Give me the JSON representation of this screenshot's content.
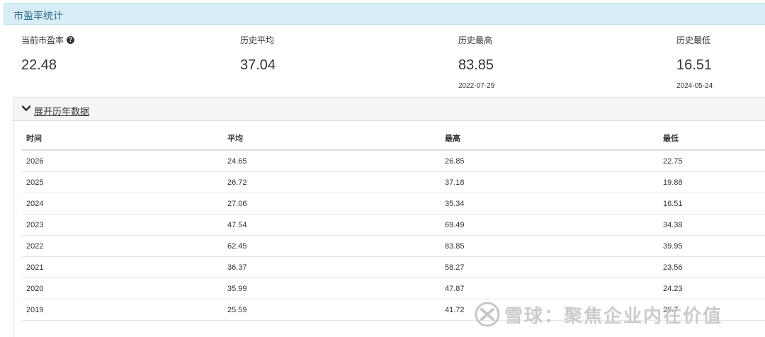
{
  "panel": {
    "title": "市盈率统计"
  },
  "stats": [
    {
      "label": "当前市盈率",
      "value": "22.48",
      "date": "",
      "has_help": true
    },
    {
      "label": "历史平均",
      "value": "37.04",
      "date": ""
    },
    {
      "label": "历史最高",
      "value": "83.85",
      "date": "2022-07-29"
    },
    {
      "label": "历史最低",
      "value": "16.51",
      "date": "2024-05-24"
    }
  ],
  "help_icon": "question-circle-icon",
  "expander": {
    "label": "展开历年数据",
    "icon": "chevron-down-icon"
  },
  "table": {
    "headers": [
      "时间",
      "平均",
      "最高",
      "最低"
    ],
    "rows": [
      [
        "2026",
        "24.65",
        "26.85",
        "22.75"
      ],
      [
        "2025",
        "26.72",
        "37.18",
        "19.88"
      ],
      [
        "2024",
        "27.06",
        "35.34",
        "16.51"
      ],
      [
        "2023",
        "47.54",
        "69.49",
        "34.38"
      ],
      [
        "2022",
        "62.45",
        "83.85",
        "39.95"
      ],
      [
        "2021",
        "36.37",
        "58.27",
        "23.56"
      ],
      [
        "2020",
        "35.99",
        "47.87",
        "24.23"
      ],
      [
        "2019",
        "25.59",
        "41.72",
        "20.7"
      ]
    ]
  },
  "watermark": {
    "text": "雪球：聚焦企业内在价值"
  },
  "colors": {
    "panel_heading_bg": "#d9edf7",
    "panel_heading_text": "#31708f",
    "expander_bg": "#f5f5f5",
    "border": "#dddddd"
  }
}
